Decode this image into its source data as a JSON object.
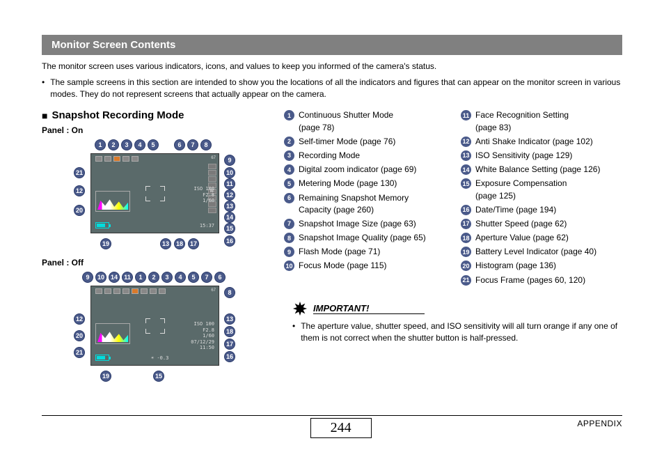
{
  "header": {
    "title": "Monitor Screen Contents"
  },
  "intro": "The monitor screen uses various indicators, icons, and values to keep you informed of the camera's status.",
  "bullet": "The sample screens in this section are intended to show you the locations of all the indicators and figures that can appear on the monitor screen in various modes. They do not represent screens that actually appear on the camera.",
  "section": {
    "title": "Snapshot Recording Mode",
    "panel_on": "Panel : On",
    "panel_off": "Panel : Off"
  },
  "screen_text": {
    "iso": "ISO 100",
    "fstop": "F2.8",
    "shutter": "1/60",
    "date": "07/12/29",
    "time": "11:50",
    "mem": "67",
    "ev": "-0.3",
    "temp": "15:37"
  },
  "legend_left": [
    {
      "n": "1",
      "text": "Continuous Shutter Mode",
      "sub": "(page 78)"
    },
    {
      "n": "2",
      "text": "Self-timer Mode (page 76)"
    },
    {
      "n": "3",
      "text": "Recording Mode"
    },
    {
      "n": "4",
      "text": "Digital zoom indicator (page 69)"
    },
    {
      "n": "5",
      "text": "Metering Mode (page 130)"
    },
    {
      "n": "6",
      "text": "Remaining Snapshot Memory",
      "sub": "Capacity (page 260)"
    },
    {
      "n": "7",
      "text": "Snapshot Image Size (page 63)"
    },
    {
      "n": "8",
      "text": "Snapshot Image Quality (page 65)"
    },
    {
      "n": "9",
      "text": "Flash Mode (page 71)"
    },
    {
      "n": "10",
      "text": "Focus Mode (page 115)"
    }
  ],
  "legend_right": [
    {
      "n": "11",
      "text": "Face Recognition Setting",
      "sub": "(page 83)"
    },
    {
      "n": "12",
      "text": "Anti Shake Indicator (page 102)"
    },
    {
      "n": "13",
      "text": "ISO Sensitivity (page 129)"
    },
    {
      "n": "14",
      "text": "White Balance Setting (page 126)"
    },
    {
      "n": "15",
      "text": "Exposure Compensation",
      "sub": "(page 125)"
    },
    {
      "n": "16",
      "text": "Date/Time (page 194)"
    },
    {
      "n": "17",
      "text": "Shutter Speed (page 62)"
    },
    {
      "n": "18",
      "text": "Aperture Value (page 62)"
    },
    {
      "n": "19",
      "text": "Battery Level Indicator (page 40)"
    },
    {
      "n": "20",
      "text": "Histogram (page 136)"
    },
    {
      "n": "21",
      "text": "Focus Frame (pages 60, 120)"
    }
  ],
  "important": {
    "label": "IMPORTANT!",
    "text": "The aperture value, shutter speed, and ISO sensitivity will all turn orange if any one of them is not correct when the shutter button is half-pressed."
  },
  "footer": {
    "page": "244",
    "appendix": "APPENDIX"
  }
}
